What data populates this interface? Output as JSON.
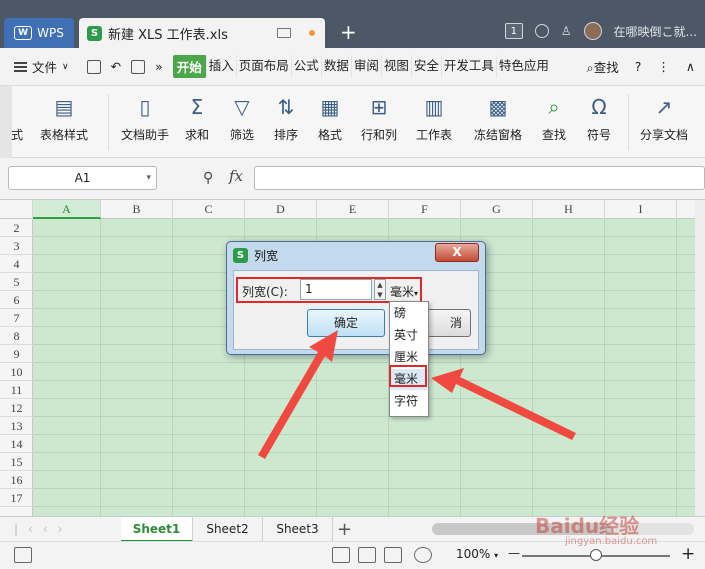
{
  "titlebar": {
    "wps_label": "WPS",
    "doc_tab_title": "新建 XLS 工作表.xls",
    "badge": "1",
    "user_text": "在哪映倒こ就..."
  },
  "menubar": {
    "file_label": "文件",
    "menus": [
      "开始",
      "插入",
      "页面布局",
      "公式",
      "数据",
      "审阅",
      "视图",
      "安全",
      "开发工具",
      "特色应用"
    ],
    "active_menu": "开始",
    "search_label": "查找",
    "help_label": "?"
  },
  "ribbon": {
    "items": [
      {
        "label": "式",
        "icon": "style-icon"
      },
      {
        "label": "表格样式",
        "icon": "table-style-icon"
      },
      {
        "label": "文档助手",
        "icon": "doc-assistant-icon"
      },
      {
        "label": "求和",
        "icon": "sum-icon"
      },
      {
        "label": "筛选",
        "icon": "filter-icon"
      },
      {
        "label": "排序",
        "icon": "sort-icon"
      },
      {
        "label": "格式",
        "icon": "format-icon"
      },
      {
        "label": "行和列",
        "icon": "row-col-icon"
      },
      {
        "label": "工作表",
        "icon": "worksheet-icon"
      },
      {
        "label": "冻结窗格",
        "icon": "freeze-icon"
      },
      {
        "label": "查找",
        "icon": "find-icon"
      },
      {
        "label": "符号",
        "icon": "symbol-icon"
      },
      {
        "label": "分享文档",
        "icon": "share-icon"
      }
    ]
  },
  "formula_bar": {
    "name_box": "A1",
    "fx_label": "fx",
    "formula": ""
  },
  "grid": {
    "columns": [
      "A",
      "B",
      "C",
      "D",
      "E",
      "F",
      "G",
      "H",
      "I"
    ],
    "selected_column": "A",
    "rows": [
      "2",
      "3",
      "4",
      "5",
      "6",
      "7",
      "8",
      "9",
      "10",
      "11",
      "12",
      "13",
      "14",
      "15",
      "16",
      "17"
    ],
    "background": "#cce8cf"
  },
  "dialog": {
    "title": "列宽",
    "field_label": "列宽(C):",
    "value": "1",
    "unit": "毫米",
    "ok_label": "确定",
    "cancel_label": "消",
    "close_label": "X",
    "unit_options": [
      "磅",
      "英寸",
      "厘米",
      "毫米",
      "字符"
    ],
    "selected_unit": "毫米"
  },
  "sheets": {
    "tabs": [
      "Sheet1",
      "Sheet2",
      "Sheet3"
    ],
    "active": "Sheet1",
    "add_label": "+"
  },
  "statusbar": {
    "zoom": "100%",
    "zoom_minus": "—",
    "zoom_plus": "+",
    "zoom_level": 1.0
  },
  "watermark": {
    "text": "Baidu经验",
    "url_text": "jingyan.baidu.com"
  },
  "colors": {
    "accent": "#2e9b4a",
    "titlebar": "#4d5866",
    "highlight_red": "#e0272a"
  }
}
